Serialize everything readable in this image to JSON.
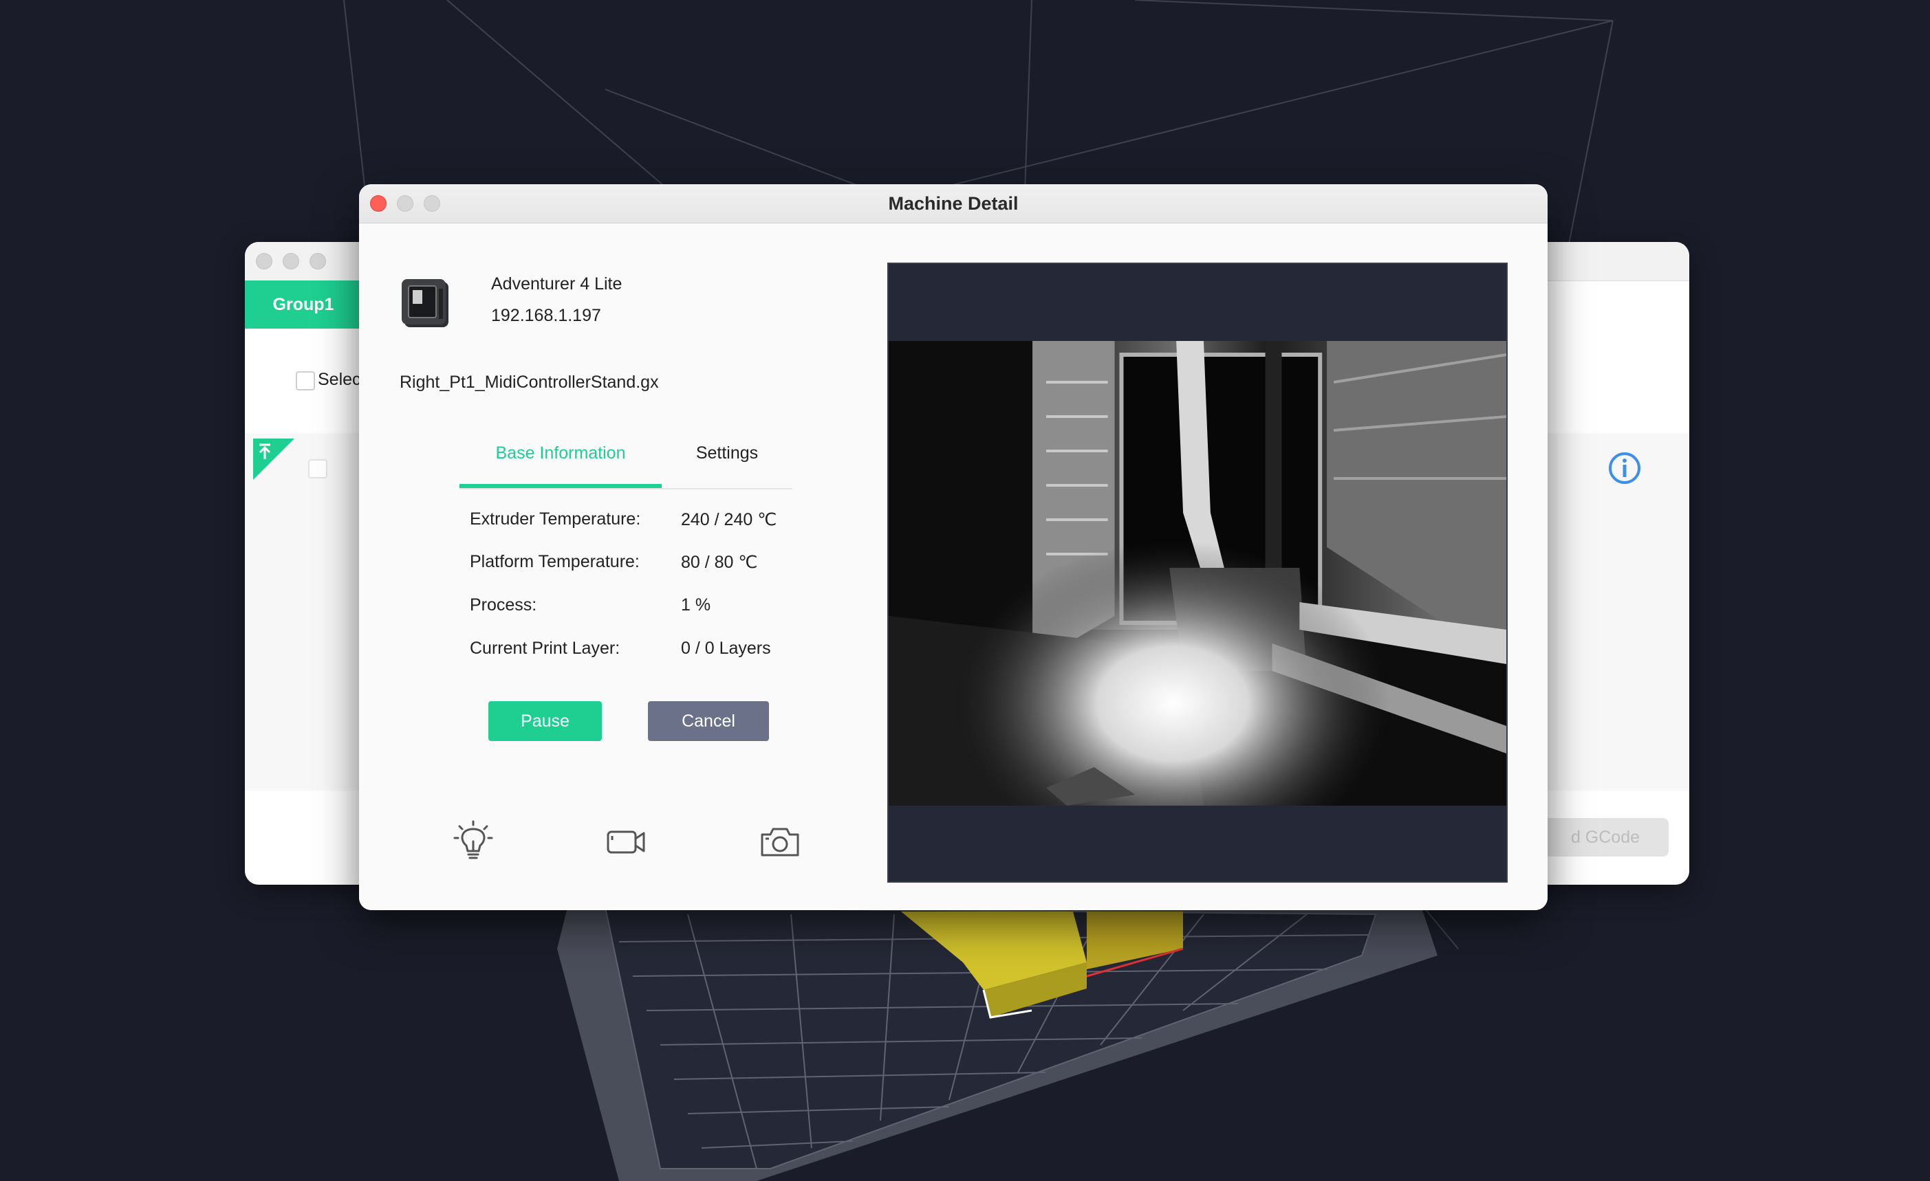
{
  "dialog": {
    "title": "Machine Detail",
    "machine_name": "Adventurer 4 Lite",
    "machine_ip": "192.168.1.197",
    "file_name": "Right_Pt1_MidiControllerStand.gx",
    "tabs": [
      {
        "label": "Base Information",
        "active": true
      },
      {
        "label": "Settings",
        "active": false
      }
    ],
    "info": [
      {
        "label": "Extruder Temperature:",
        "value": "240 / 240 ℃"
      },
      {
        "label": "Platform Temperature:",
        "value": "80 / 80 ℃"
      },
      {
        "label": "Process:",
        "value": "1 %"
      },
      {
        "label": "Current Print Layer:",
        "value": "0 / 0 Layers"
      }
    ],
    "buttons": {
      "pause": "Pause",
      "cancel": "Cancel"
    },
    "tools": [
      "lightbulb-icon",
      "video-camera-icon",
      "camera-icon"
    ]
  },
  "back_window": {
    "group_tab": "Group1",
    "select_label": "Selec",
    "upload_button": "d GCode"
  },
  "colors": {
    "accent": "#1ecf91",
    "cancel": "#6b7188",
    "background": "#1a1d29",
    "info_icon": "#3f8ee8"
  }
}
